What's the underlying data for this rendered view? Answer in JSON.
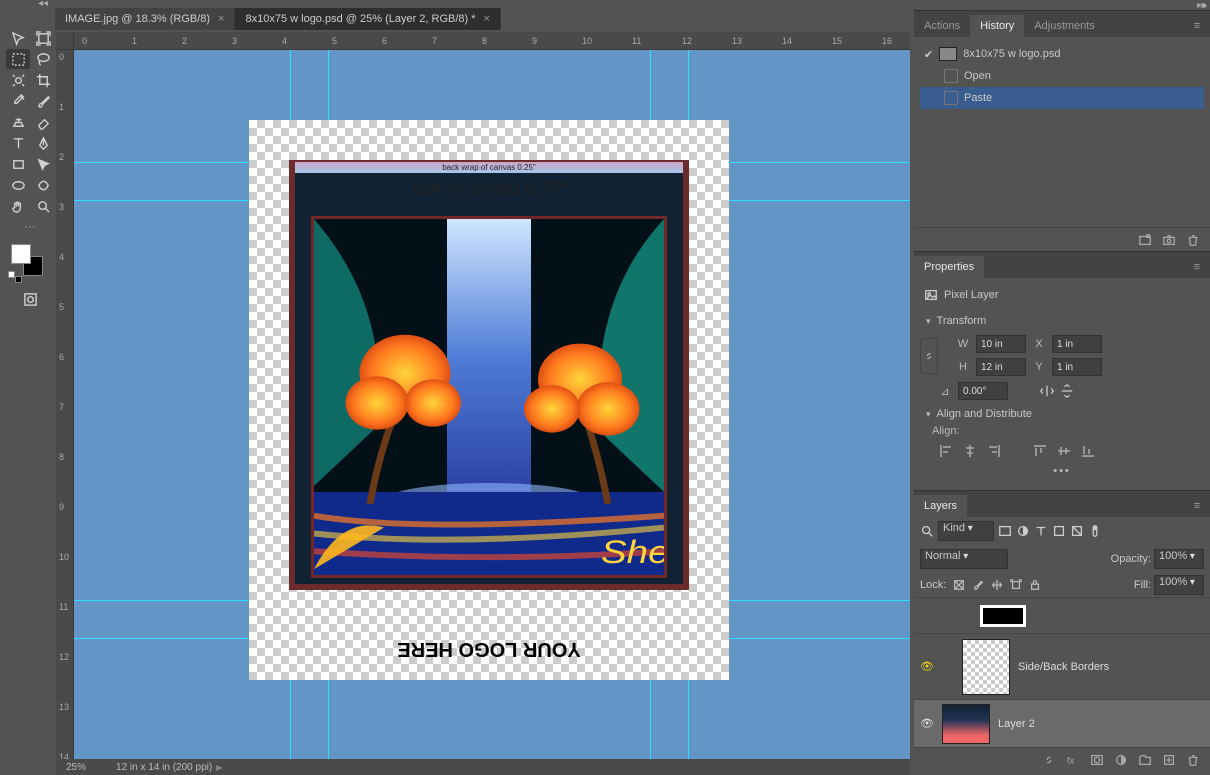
{
  "top": {
    "chev": "◂◂"
  },
  "tabs": [
    {
      "label": "IMAGE.jpg @ 18.3% (RGB/8)",
      "active": false
    },
    {
      "label": "8x10x75 w logo.psd @ 25% (Layer 2, RGB/8) *",
      "active": true
    }
  ],
  "ruler_top": [
    "0",
    "1",
    "2",
    "3",
    "4",
    "5",
    "6",
    "7",
    "8",
    "9",
    "10",
    "11",
    "12",
    "13",
    "14",
    "15",
    "16"
  ],
  "ruler_left": [
    "0",
    "1",
    "2",
    "3",
    "4",
    "5",
    "6",
    "7",
    "8",
    "9",
    "10",
    "11",
    "12",
    "13",
    "14"
  ],
  "canvas": {
    "wrap_label": "back wrap of canvas 0.25\"",
    "side_label": "side of canvas 0.75\"",
    "logo_placeholder": "YOUR LOGO HERE"
  },
  "status": {
    "zoom": "25%",
    "dims": "12 in x 14 in (200 ppi)"
  },
  "history_panel": {
    "tabs": [
      "Actions",
      "History",
      "Adjustments"
    ],
    "active": 1,
    "doc": "8x10x75 w logo.psd",
    "items": [
      "Open",
      "Paste"
    ],
    "selected": 1
  },
  "properties_panel": {
    "title": "Properties",
    "kind": "Pixel Layer",
    "sections": {
      "transform": {
        "title": "Transform",
        "W": "10 in",
        "H": "12 in",
        "X": "1 in",
        "Y": "1 in",
        "angle": "0.00°"
      },
      "align": {
        "title": "Align and Distribute",
        "sub": "Align:"
      }
    }
  },
  "layers_panel": {
    "title": "Layers",
    "filter": "Kind",
    "blend": "Normal",
    "opacity_label": "Opacity:",
    "opacity": "100%",
    "lock_label": "Lock:",
    "fill_label": "Fill:",
    "fill": "100%",
    "layers": [
      {
        "name": "",
        "thumb": "mask",
        "vis": false
      },
      {
        "name": "Side/Back Borders",
        "thumb": "checker",
        "vis": true
      },
      {
        "name": "Layer 2",
        "thumb": "painting",
        "vis": true,
        "selected": true
      }
    ]
  }
}
